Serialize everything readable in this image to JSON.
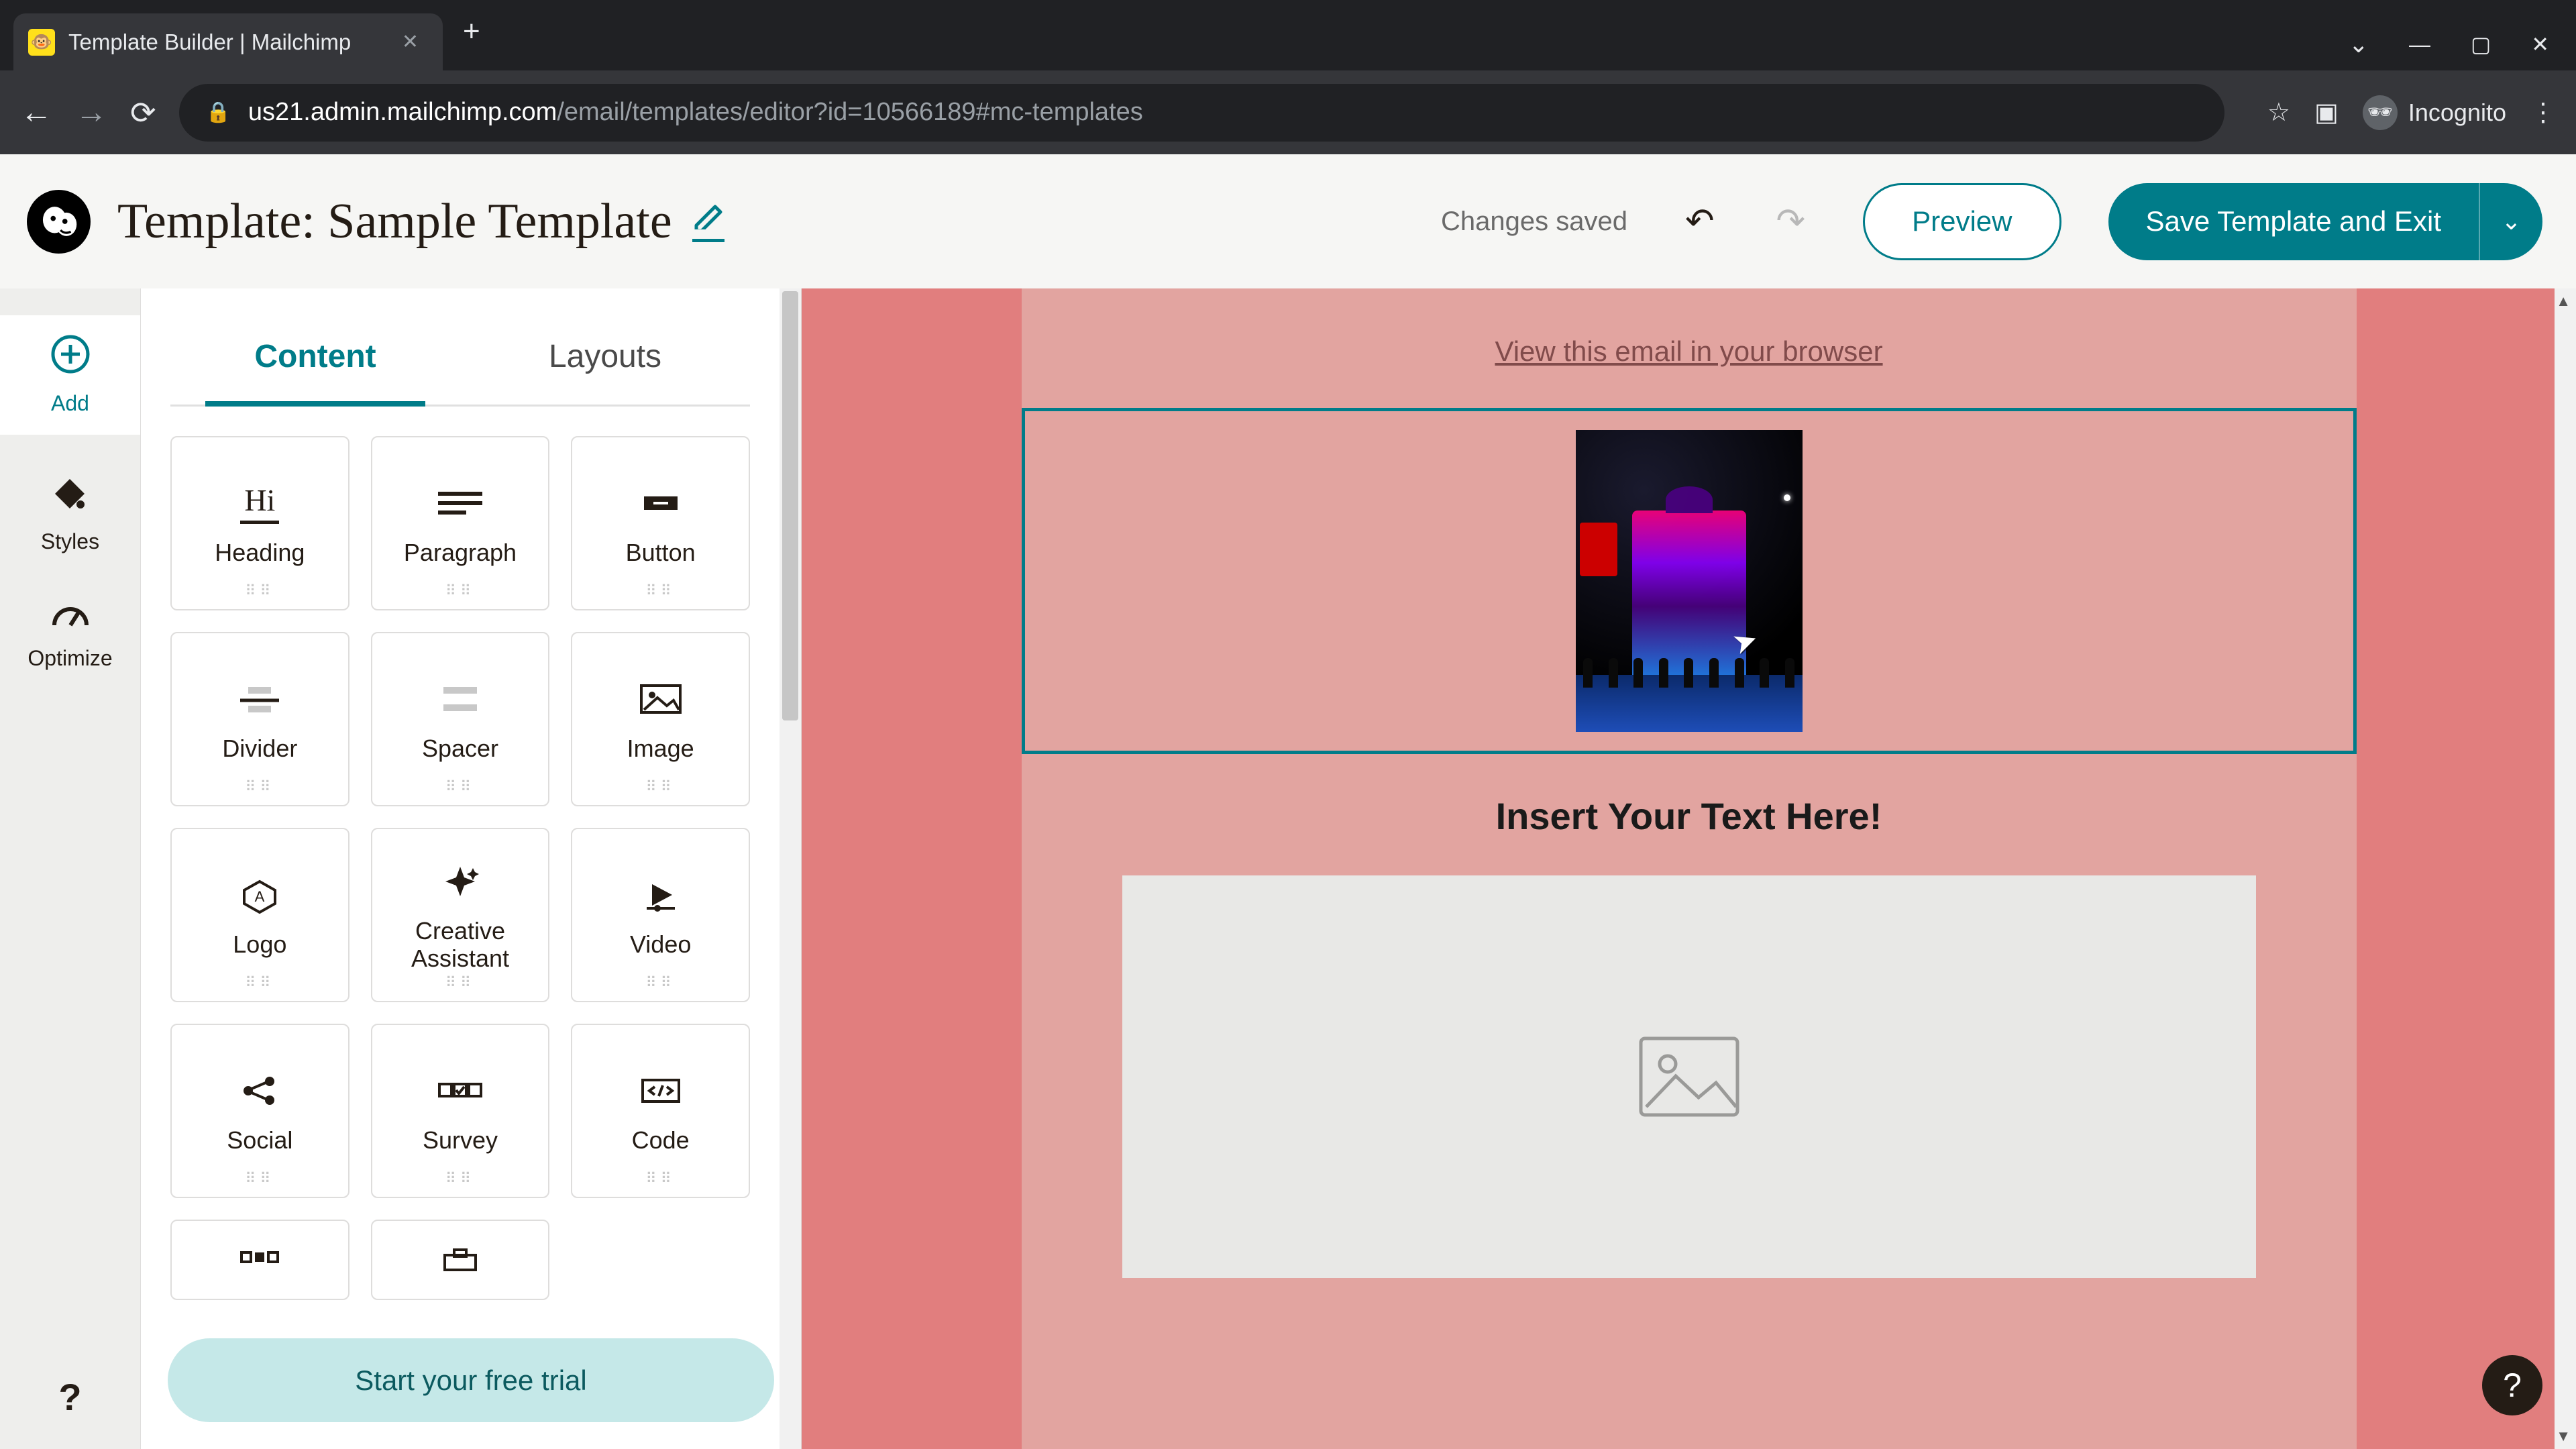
{
  "browser": {
    "tab_title": "Template Builder | Mailchimp",
    "url_secure_host": "us21.admin.mailchimp.com",
    "url_path": "/email/templates/editor?id=10566189#mc-templates",
    "incognito_label": "Incognito"
  },
  "header": {
    "title": "Template: Sample Template",
    "status": "Changes saved",
    "preview": "Preview",
    "save": "Save Template and Exit"
  },
  "rail": {
    "add": "Add",
    "styles": "Styles",
    "optimize": "Optimize"
  },
  "side": {
    "tabs": {
      "content": "Content",
      "layouts": "Layouts"
    },
    "blocks": {
      "heading_icon_text": "Hi",
      "heading": "Heading",
      "paragraph": "Paragraph",
      "button": "Button",
      "divider": "Divider",
      "spacer": "Spacer",
      "image": "Image",
      "logo": "Logo",
      "creative": "Creative\nAssistant",
      "video": "Video",
      "social": "Social",
      "survey": "Survey",
      "code": "Code"
    },
    "trial": "Start your free trial"
  },
  "canvas": {
    "view_browser": "View this email in your browser",
    "heading": "Insert Your Text Here!"
  }
}
